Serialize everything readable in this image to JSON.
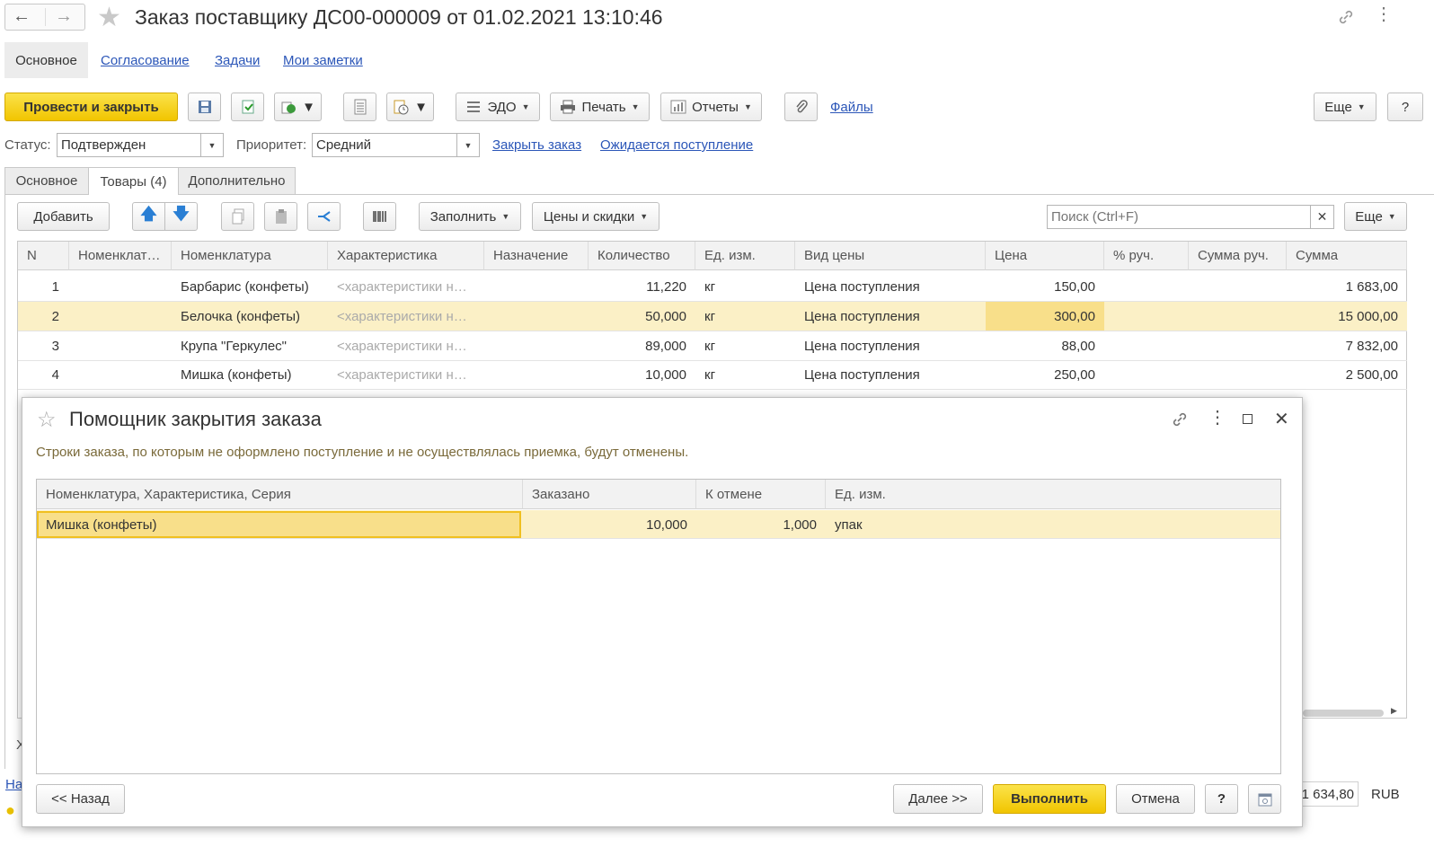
{
  "window": {
    "title": "Заказ поставщику ДС00-000009 от 01.02.2021 13:10:46"
  },
  "nav_links": [
    "Основное",
    "Согласование",
    "Задачи",
    "Мои заметки"
  ],
  "toolbar": {
    "post_close": "Провести и закрыть",
    "edo": "ЭДО",
    "print": "Печать",
    "reports": "Отчеты",
    "files": "Файлы",
    "more": "Еще",
    "help": "?"
  },
  "status_row": {
    "status_label": "Статус:",
    "status_value": "Подтвержден",
    "priority_label": "Приоритет:",
    "priority_value": "Средний",
    "close_order": "Закрыть заказ",
    "awaiting": "Ожидается поступление"
  },
  "tabs": [
    "Основное",
    "Товары (4)",
    "Дополнительно"
  ],
  "goods_toolbar": {
    "add": "Добавить",
    "fill": "Заполнить",
    "prices": "Цены и скидки",
    "search_placeholder": "Поиск (Ctrl+F)",
    "more": "Еще"
  },
  "goods_table": {
    "columns": [
      "N",
      "Номенклат…",
      "Номенклатура",
      "Характеристика",
      "Назначение",
      "Количество",
      "Ед. изм.",
      "Вид цены",
      "Цена",
      "% руч.",
      "Сумма руч.",
      "Сумма"
    ],
    "rows": [
      {
        "n": "1",
        "name": "Барбарис (конфеты)",
        "char": "<характеристики н…",
        "qty": "11,220",
        "unit": "кг",
        "price_type": "Цена поступления",
        "price": "150,00",
        "sum": "1 683,00"
      },
      {
        "n": "2",
        "name": "Белочка (конфеты)",
        "char": "<характеристики н…",
        "qty": "50,000",
        "unit": "кг",
        "price_type": "Цена поступления",
        "price": "300,00",
        "sum": "15 000,00"
      },
      {
        "n": "3",
        "name": "Крупа \"Геркулес\"",
        "char": "<характеристики н…",
        "qty": "89,000",
        "unit": "кг",
        "price_type": "Цена поступления",
        "price": "88,00",
        "sum": "7 832,00"
      },
      {
        "n": "4",
        "name": "Мишка (конфеты)",
        "char": "<характеристики н…",
        "qty": "10,000",
        "unit": "кг",
        "price_type": "Цена поступления",
        "price": "250,00",
        "sum": "2 500,00"
      }
    ]
  },
  "footer_peek": {
    "left_char": "Х",
    "left_link": "На",
    "total": "1 634,80",
    "currency": "RUB"
  },
  "dialog": {
    "title": "Помощник закрытия заказа",
    "message": "Строки заказа, по которым не оформлено поступление и не осуществлялась приемка, будут отменены.",
    "columns": [
      "Номенклатура, Характеристика, Серия",
      "Заказано",
      "К отмене",
      "Ед. изм."
    ],
    "rows": [
      {
        "name": "Мишка (конфеты)",
        "ordered": "10,000",
        "cancel": "1,000",
        "unit": "упак"
      }
    ],
    "back": "<< Назад",
    "next": "Далее >>",
    "execute": "Выполнить",
    "cancel": "Отмена",
    "help": "?"
  }
}
